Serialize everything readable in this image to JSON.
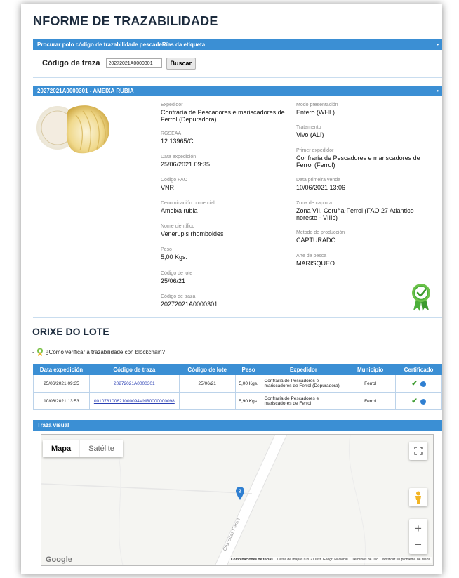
{
  "page": {
    "title": "NFORME DE TRAZABILIDADE"
  },
  "search": {
    "bar_label": "Procurar polo código de trazabilidade pescadeRías da etiqueta",
    "field_label": "Código de traza",
    "value": "20272021A0000301",
    "button": "Buscar"
  },
  "product": {
    "bar_label": "20272021A0000301 - AMEIXA RUBIA",
    "left": [
      {
        "label": "Expedidor",
        "value": "Confraría de Pescadores e mariscadores de Ferrol (Depuradora)"
      },
      {
        "label": "RGSEAA",
        "value": "12.13965/C"
      },
      {
        "label": "Data expedición",
        "value": "25/06/2021 09:35"
      },
      {
        "label": "Código FAO",
        "value": "VNR"
      },
      {
        "label": "Denominación comercial",
        "value": "Ameixa rubia"
      },
      {
        "label": "Nome científico",
        "value": "Venerupis rhomboides"
      },
      {
        "label": "Peso",
        "value": "5,00 Kgs."
      },
      {
        "label": "Código de lote",
        "value": "25/06/21"
      },
      {
        "label": "Código de traza",
        "value": "20272021A0000301"
      }
    ],
    "right": [
      {
        "label": "Modo presentación",
        "value": "Entero (WHL)"
      },
      {
        "label": "Tratamento",
        "value": "Vivo (ALI)"
      },
      {
        "label": "Primer expedidor",
        "value": "Confraría de Pescadores e mariscadores de Ferrol (Ferrol)"
      },
      {
        "label": "Data primeira venda",
        "value": "10/06/2021 13:06"
      },
      {
        "label": "Zona de captura",
        "value": "Zona VII. Coruña-Ferrol (FAO 27 Atlántico noreste - VIIIc)"
      },
      {
        "label": "Metodo de producción",
        "value": "CAPTURADO"
      },
      {
        "label": "Arte de pesca",
        "value": "MARISQUEO"
      }
    ],
    "certified_badge_icon": "certified-ribbon-icon"
  },
  "lot": {
    "section_title": "ORIXE DO LOTE",
    "verify_prefix": "-",
    "verify_link": "¿Cómo verificar a trazabilidade con blockchain?",
    "columns": [
      "Data expedición",
      "Código de traza",
      "Código de lote",
      "Peso",
      "Expedidor",
      "Municipio",
      "Certificado"
    ],
    "rows": [
      {
        "date": "25/06/2021 09:35",
        "trace": "20272021A0000301",
        "lot": "25/06/21",
        "weight": "5,00 Kgs.",
        "shipper": "Confraría de Pescadores e mariscadores de Ferrol (Depuradora)",
        "municipality": "Ferrol",
        "certified": "✔"
      },
      {
        "date": "10/06/2021 13:53",
        "trace": "001078100621000094VNR0000000098",
        "lot": "",
        "weight": "5,90 Kgs.",
        "shipper": "Confraría de Pescadores e mariscadores de Ferrol",
        "municipality": "Ferrol",
        "certified": "✔"
      }
    ]
  },
  "map": {
    "bar_label": "Traza visual",
    "tab_map": "Mapa",
    "tab_satellite": "Satélite",
    "marker_label": "2",
    "street_name": "Cruceiras Ferrol",
    "logo": "Google",
    "attribution": [
      "Combinaciones de teclas",
      "Datos de mapas ©2021 Inst. Geogr. Nacional",
      "Términos de uso",
      "Notificar un problema de Maps"
    ],
    "zoom_in": "+",
    "zoom_out": "−"
  },
  "colors": {
    "bar_blue": "#3b8fd4",
    "title_dark": "#1c2b3d",
    "check_green": "#3c9a2e"
  }
}
